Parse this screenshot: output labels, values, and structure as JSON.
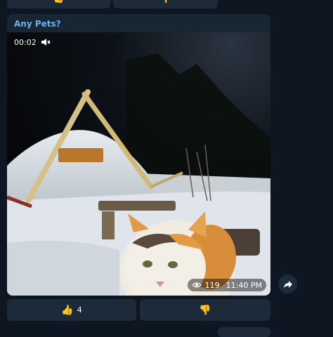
{
  "top_row": {
    "left_emoji": "👍",
    "right_emoji": "👎"
  },
  "message": {
    "sender": "Any Pets?",
    "video": {
      "duration": "00:02",
      "muted": true,
      "views": "119",
      "time": "11:40 PM"
    }
  },
  "reactions": {
    "like_emoji": "👍",
    "like_count": "4",
    "dislike_emoji": "👎"
  },
  "colors": {
    "background": "#0e1621",
    "bubble": "#182533",
    "button": "#1c2a3a",
    "sender": "#6ab3f3",
    "thumb": "#f5b83d"
  },
  "icons": [
    "mute-icon",
    "eye-icon",
    "share-icon",
    "thumbs-up-icon",
    "thumbs-down-icon"
  ]
}
